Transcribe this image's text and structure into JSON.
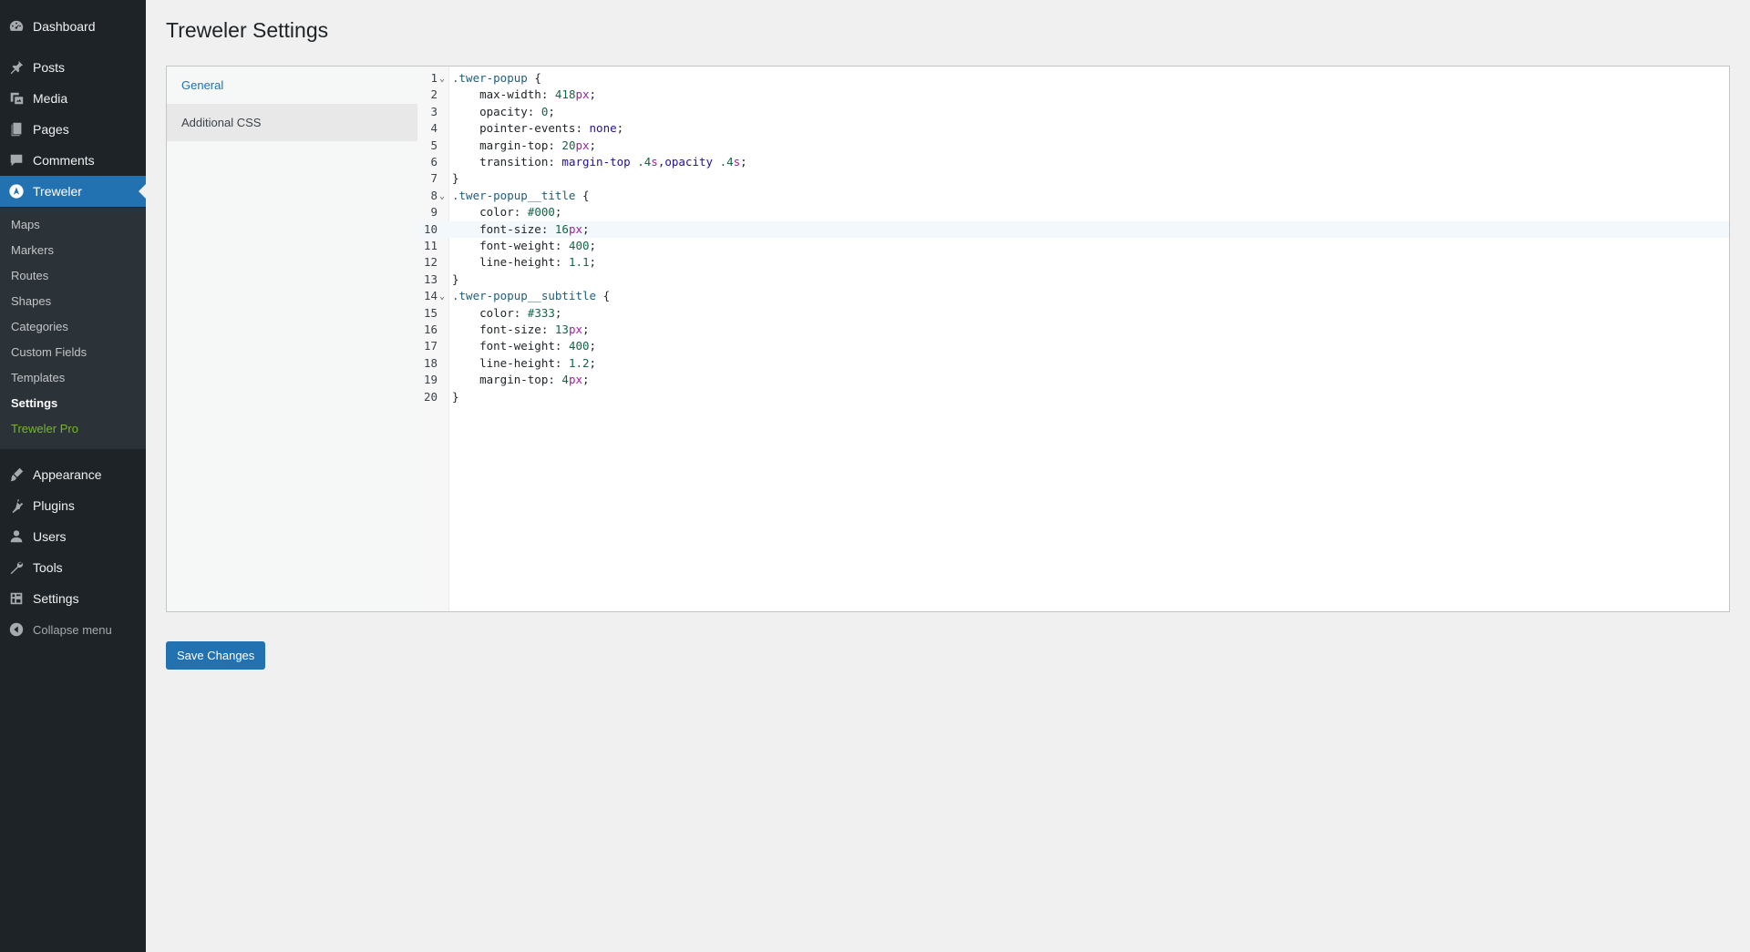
{
  "sidebar": {
    "top_items": [
      {
        "label": "Dashboard",
        "icon": "dashboard-icon"
      },
      {
        "label": "Posts",
        "icon": "pin-icon"
      },
      {
        "label": "Media",
        "icon": "media-icon"
      },
      {
        "label": "Pages",
        "icon": "pages-icon"
      },
      {
        "label": "Comments",
        "icon": "comment-icon"
      },
      {
        "label": "Treweler",
        "icon": "treweler-logo-icon"
      }
    ],
    "submenu": [
      "Maps",
      "Markers",
      "Routes",
      "Shapes",
      "Categories",
      "Custom Fields",
      "Templates",
      "Settings",
      "Treweler Pro"
    ],
    "bottom_items": [
      {
        "label": "Appearance",
        "icon": "brush-icon"
      },
      {
        "label": "Plugins",
        "icon": "plugin-icon"
      },
      {
        "label": "Users",
        "icon": "user-icon"
      },
      {
        "label": "Tools",
        "icon": "wrench-icon"
      },
      {
        "label": "Settings",
        "icon": "settings-icon"
      }
    ],
    "collapse_label": "Collapse menu",
    "accent_color": "#2271b1",
    "pro_color": "#74b72e"
  },
  "page": {
    "title": "Treweler Settings",
    "tabs": [
      "General",
      "Additional CSS"
    ],
    "save_label": "Save Changes"
  },
  "editor": {
    "highlighted_line": 10,
    "line_numbers": [
      "1",
      "2",
      "3",
      "4",
      "5",
      "6",
      "7",
      "8",
      "9",
      "10",
      "11",
      "12",
      "13",
      "14",
      "15",
      "16",
      "17",
      "18",
      "19",
      "20"
    ],
    "lines": [
      ".twer-popup {",
      "    max-width: 418px;",
      "    opacity: 0;",
      "    pointer-events: none;",
      "    margin-top: 20px;",
      "    transition: margin-top .4s,opacity .4s;",
      "}",
      ".twer-popup__title {",
      "    color: #000;",
      "    font-size: 16px;",
      "    font-weight: 400;",
      "    line-height: 1.1;",
      "}",
      ".twer-popup__subtitle {",
      "    color: #333;",
      "    font-size: 13px;",
      "    font-weight: 400;",
      "    line-height: 1.2;",
      "    margin-top: 4px;",
      "}"
    ]
  }
}
